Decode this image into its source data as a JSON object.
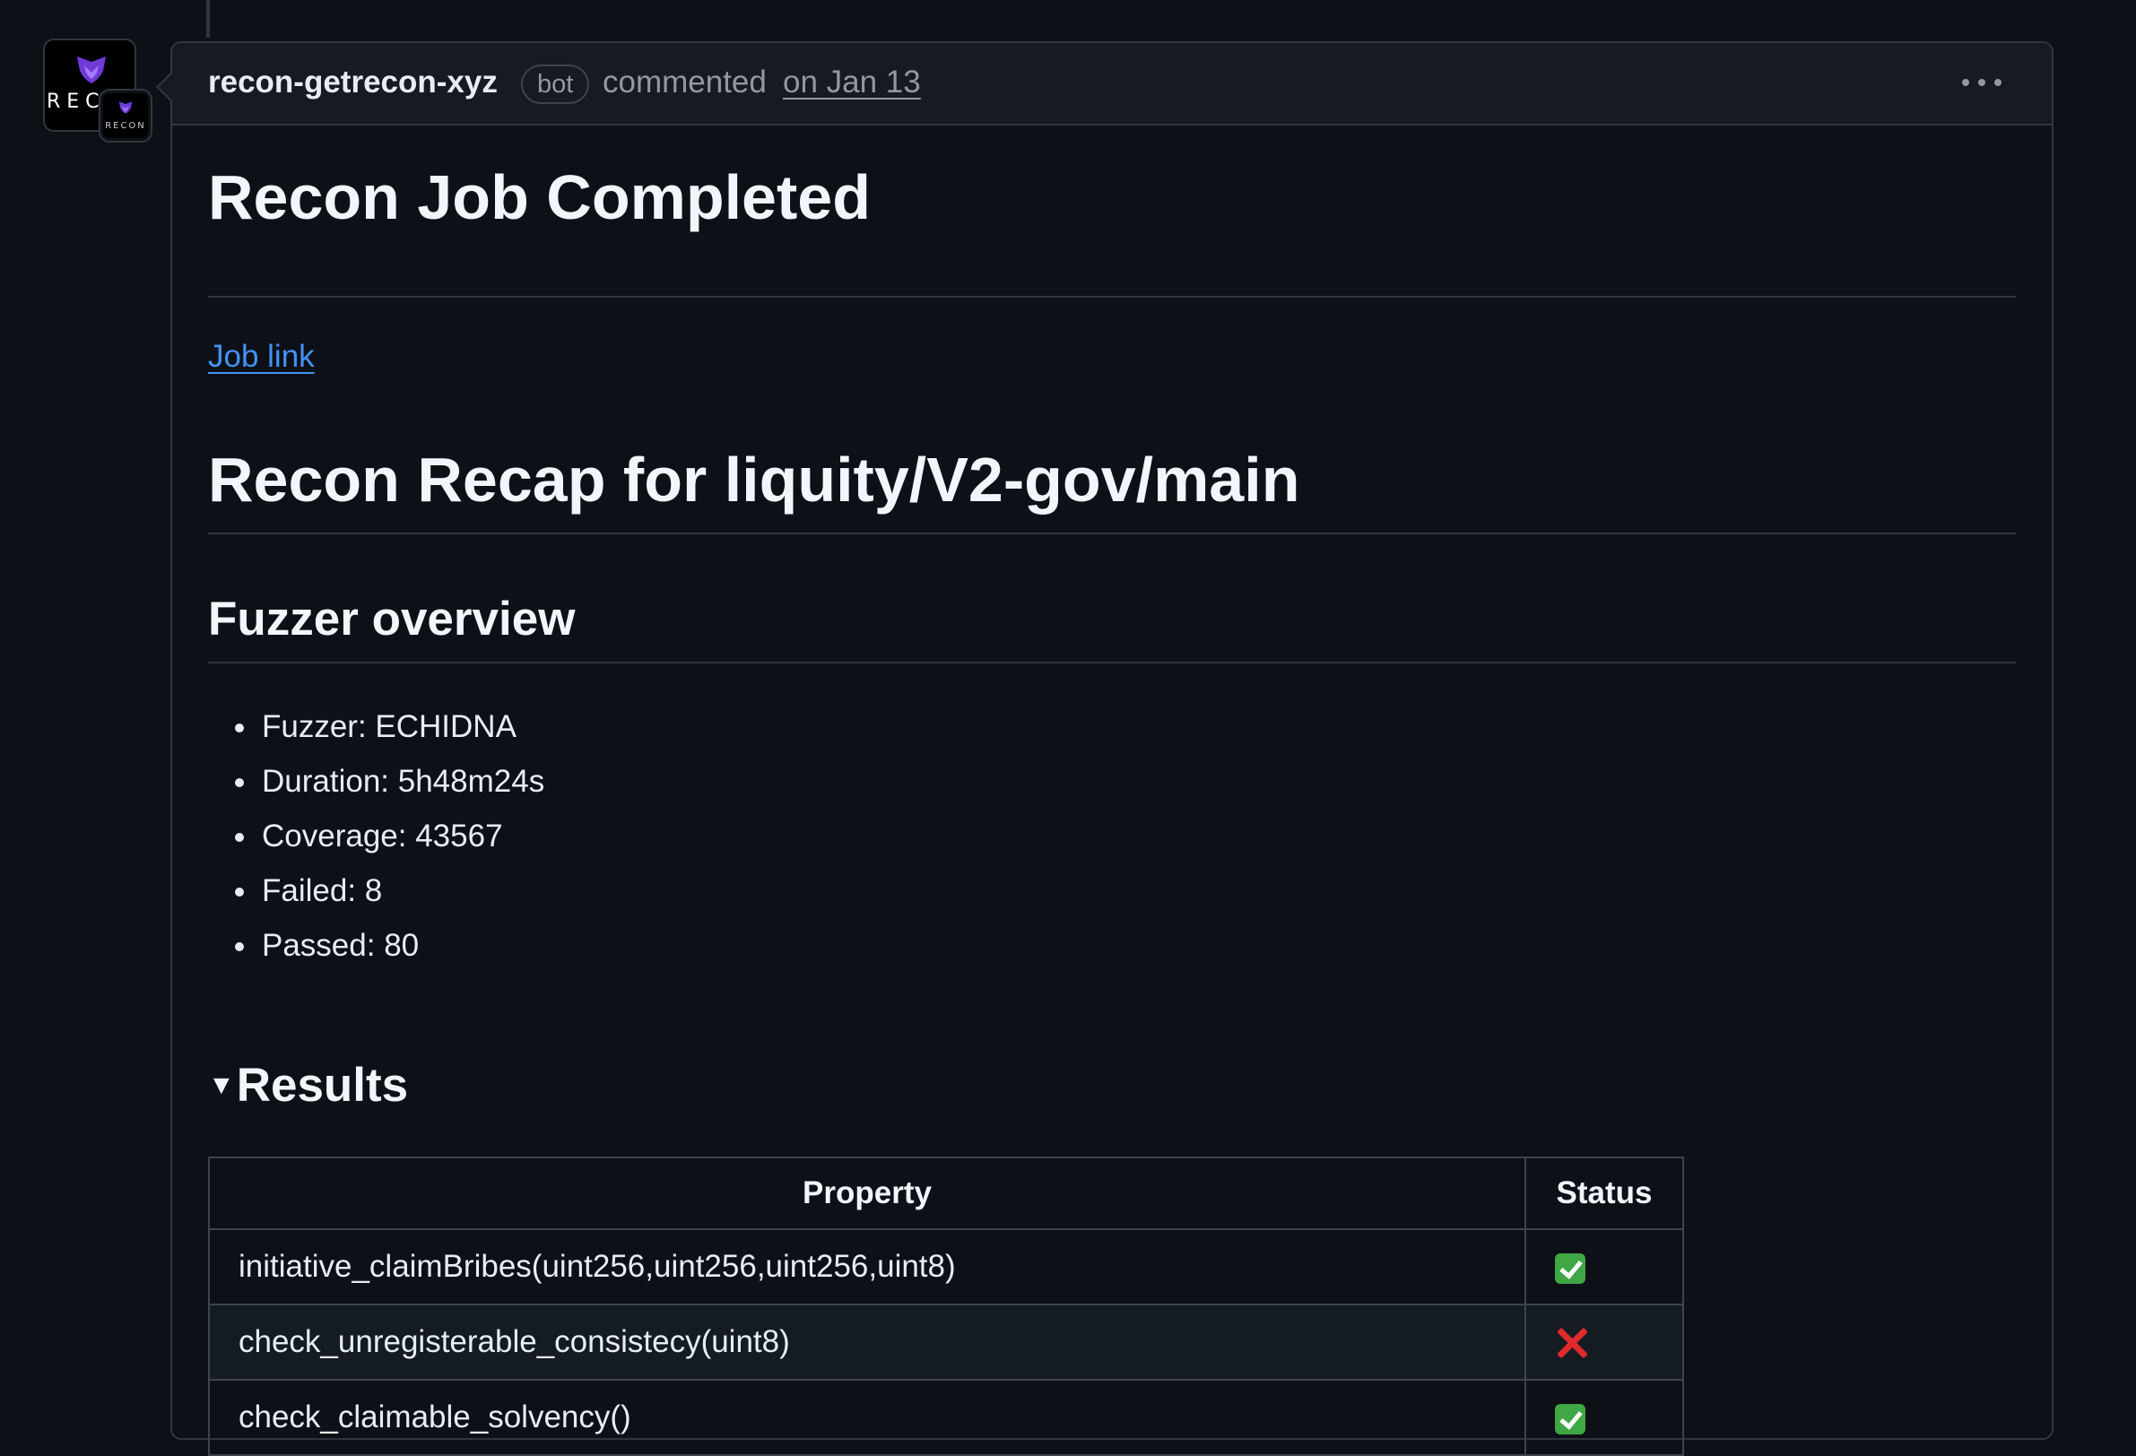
{
  "comment": {
    "author": "recon-getrecon-xyz",
    "badge": "bot",
    "action": "commented",
    "date": "on Jan 13",
    "avatar_text": "RECON",
    "avatar_small_text": "RECON",
    "menu_icon": "kebab-horizontal-icon"
  },
  "body": {
    "title": "Recon Job Completed",
    "job_link": "Job link",
    "recap_title": "Recon Recap for liquity/V2-gov/main",
    "overview_title": "Fuzzer overview",
    "overview": [
      "Fuzzer: ECHIDNA",
      "Duration: 5h48m24s",
      "Coverage: 43567",
      "Failed: 8",
      "Passed: 80"
    ],
    "results_title": "Results",
    "table": {
      "headers": [
        "Property",
        "Status"
      ],
      "rows": [
        {
          "property": "initiative_claimBribes(uint256,uint256,uint256,uint8)",
          "status": "pass"
        },
        {
          "property": "check_unregisterable_consistecy(uint8)",
          "status": "fail"
        },
        {
          "property": "check_claimable_solvency()",
          "status": "pass"
        }
      ]
    }
  },
  "colors": {
    "background": "#0d1117",
    "link": "#4493f8",
    "pass": "#3fa743",
    "fail": "#e02b2b",
    "avatar_accent": "#7b3fe4"
  }
}
